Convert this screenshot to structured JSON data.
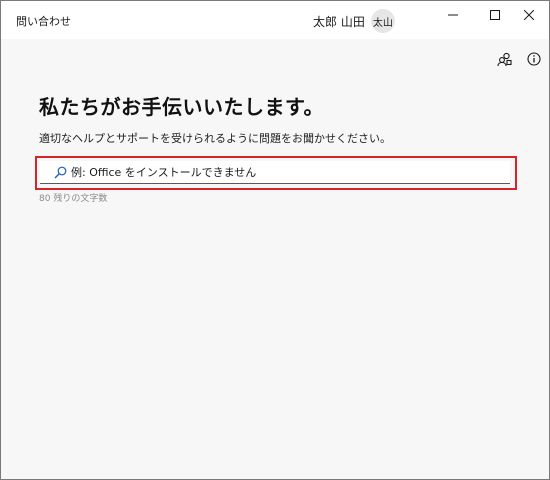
{
  "window": {
    "title": "問い合わせ"
  },
  "user": {
    "name": "太郎 山田",
    "avatar_initials": "太山"
  },
  "icons": {
    "minimize": "minimize-icon",
    "maximize": "maximize-icon",
    "close": "close-icon",
    "toolbar_left": "community-icon",
    "toolbar_right": "info-icon",
    "search": "search-icon"
  },
  "main": {
    "heading": "私たちがお手伝いいたします。",
    "subheading": "適切なヘルプとサポートを受けられるように問題をお聞かせください。",
    "search": {
      "value": "",
      "placeholder": "例: Office をインストールできません"
    },
    "char_counter": "80 残りの文字数"
  },
  "colors": {
    "highlight_border": "#d8232a",
    "background": "#f7f7f7",
    "titlebar": "#ffffff"
  }
}
